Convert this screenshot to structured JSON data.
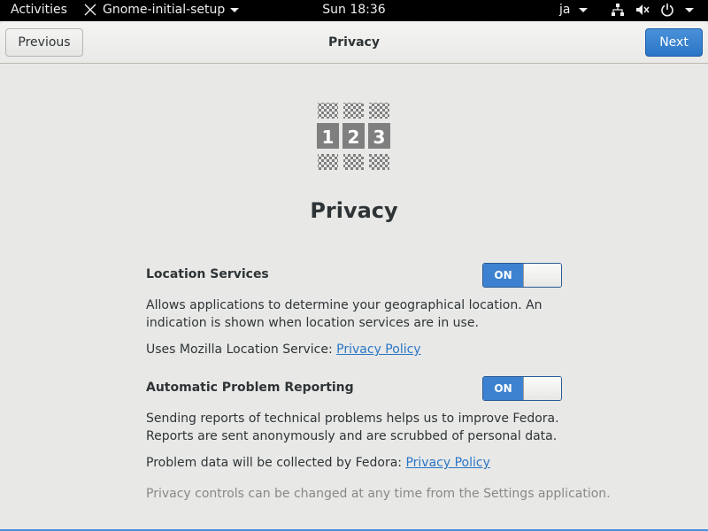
{
  "topbar": {
    "activities": "Activities",
    "app_name": "Gnome-initial-setup",
    "clock": "Sun 18:36",
    "language": "ja",
    "icons": [
      "network-icon",
      "speaker-muted-icon",
      "power-icon"
    ]
  },
  "headerbar": {
    "previous_label": "Previous",
    "title": "Privacy",
    "next_label": "Next"
  },
  "page": {
    "title": "Privacy",
    "location": {
      "label": "Location Services",
      "toggle_label": "ON",
      "desc_line1": "Allows applications to determine your geographical location. An",
      "desc_line2": "indication is shown when location services are in use.",
      "service_text": "Uses Mozilla Location Service: ",
      "link_text": "Privacy Policy"
    },
    "reporting": {
      "label": "Automatic Problem Reporting",
      "toggle_label": "ON",
      "desc_line1": "Sending reports of technical problems helps us to improve Fedora.",
      "desc_line2": "Reports are sent anonymously and are scrubbed of personal data.",
      "service_text": "Problem data will be collected by Fedora: ",
      "link_text": "Privacy Policy"
    },
    "footnote": "Privacy controls can be changed at any time from the Settings application."
  },
  "colors": {
    "accent": "#3d82d1",
    "link": "#2a76c6",
    "background": "#e8e8e7"
  }
}
